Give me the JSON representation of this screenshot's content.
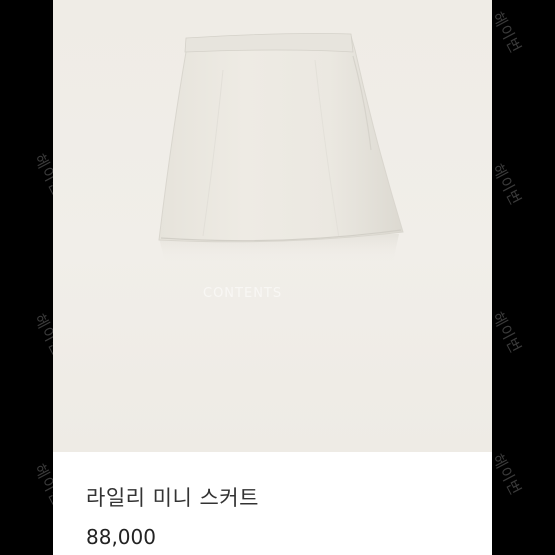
{
  "product": {
    "name": "라일리 미니 스커트",
    "price": "88,000",
    "image_label": "white-a-line-mini-skirt"
  },
  "watermarks": {
    "side_text": "헤이번",
    "photo_text": "CONTENTS"
  },
  "colors": {
    "background": "#000000",
    "card": "#ffffff",
    "photo_bg": "#efece6",
    "skirt": "#ece9e2",
    "text": "#333333",
    "price_text": "#222222"
  }
}
